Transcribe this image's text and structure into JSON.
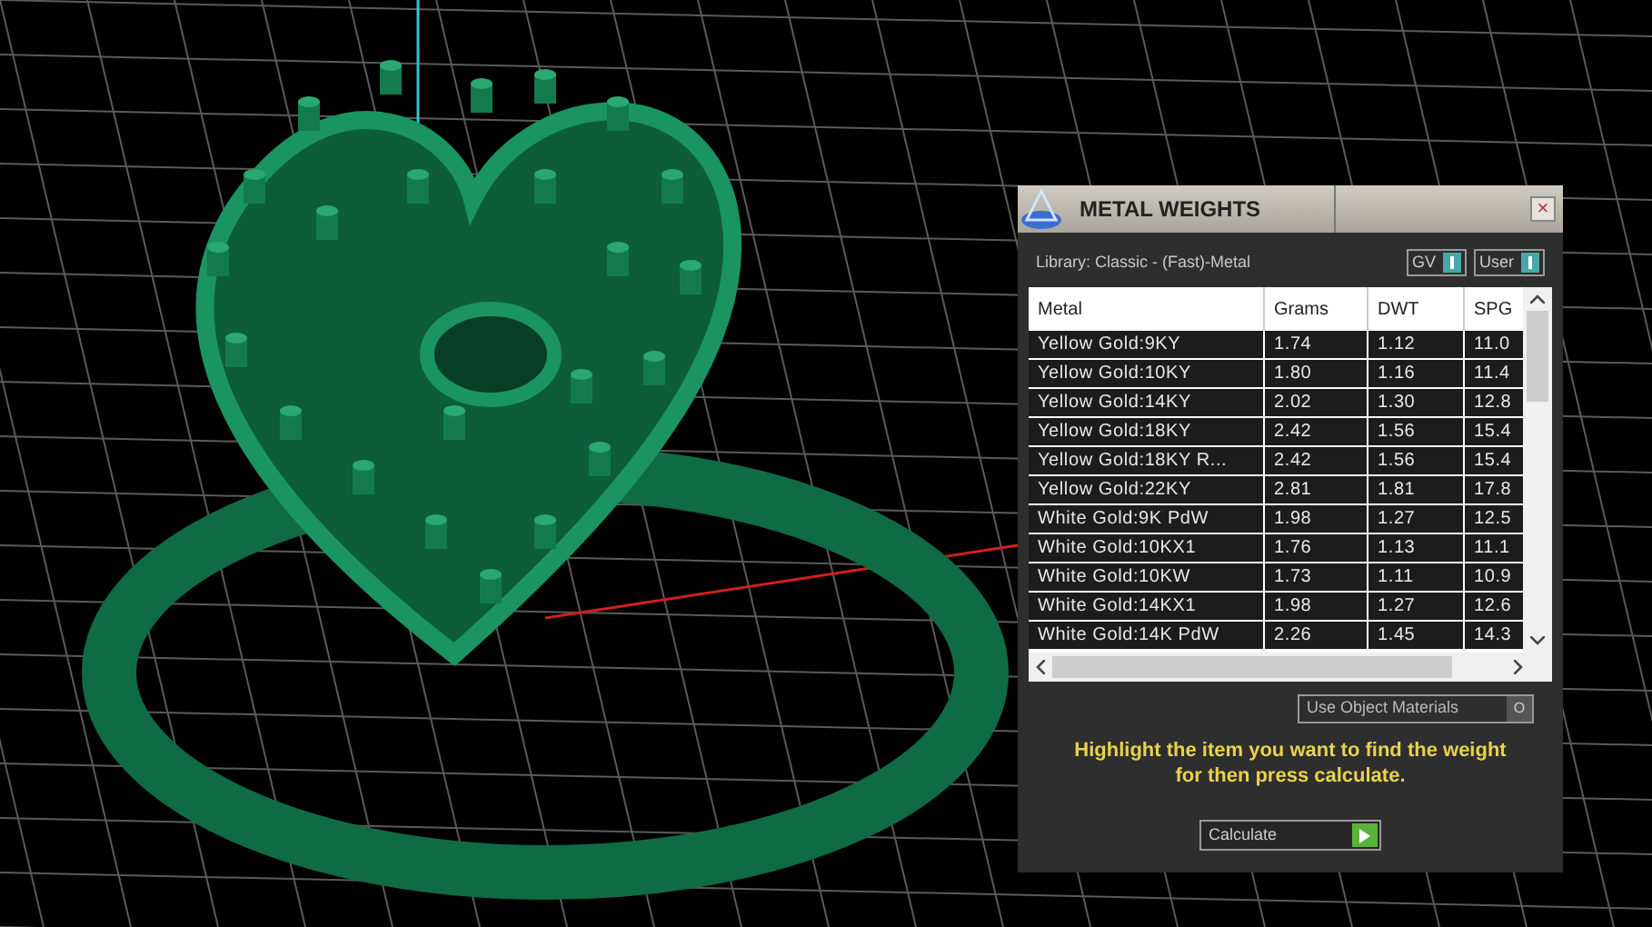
{
  "panel": {
    "title": "METAL WEIGHTS",
    "close": "×",
    "library": "Library: Classic - (Fast)-Metal",
    "toggles": [
      {
        "label": "GV",
        "on": true
      },
      {
        "label": "User",
        "on": true
      }
    ],
    "table": {
      "columns": [
        "Metal",
        "Grams",
        "DWT",
        "SPG"
      ],
      "rows": [
        [
          "Yellow Gold:9KY",
          "1.74",
          "1.12",
          "11.0"
        ],
        [
          "Yellow Gold:10KY",
          "1.80",
          "1.16",
          "11.4"
        ],
        [
          "Yellow Gold:14KY",
          "2.02",
          "1.30",
          "12.8"
        ],
        [
          "Yellow Gold:18KY",
          "2.42",
          "1.56",
          "15.4"
        ],
        [
          "Yellow Gold:18KY R...",
          "2.42",
          "1.56",
          "15.4"
        ],
        [
          "Yellow Gold:22KY",
          "2.81",
          "1.81",
          "17.8"
        ],
        [
          "White Gold:9K PdW",
          "1.98",
          "1.27",
          "12.5"
        ],
        [
          "White Gold:10KX1",
          "1.76",
          "1.13",
          "11.1"
        ],
        [
          "White Gold:10KW",
          "1.73",
          "1.11",
          "10.9"
        ],
        [
          "White Gold:14KX1",
          "1.98",
          "1.27",
          "12.6"
        ],
        [
          "White Gold:14K PdW",
          "2.26",
          "1.45",
          "14.3"
        ]
      ]
    },
    "use_object_materials": {
      "label": "Use Object Materials",
      "on": false,
      "toggle_text": "O"
    },
    "hint": "Highlight the item you want to find the weight for then press calculate.",
    "calculate": "Calculate"
  }
}
